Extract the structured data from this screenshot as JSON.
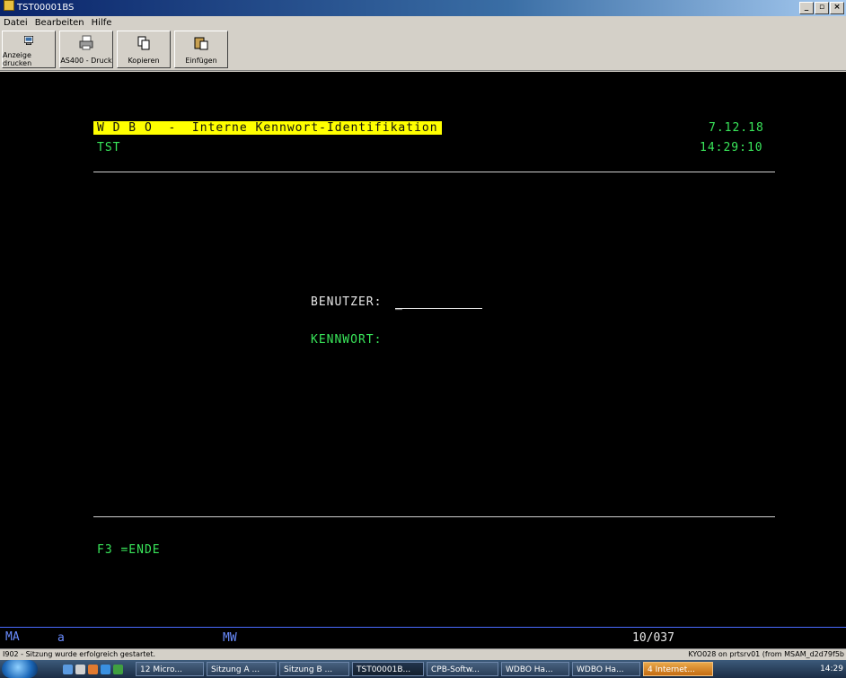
{
  "window": {
    "title": "TST00001BS"
  },
  "menu": [
    "Datei",
    "Bearbeiten",
    "Hilfe"
  ],
  "toolbar": [
    {
      "label": "Anzeige drucken",
      "icon": "print-screen-icon"
    },
    {
      "label": "AS400 - Druck",
      "icon": "printer-icon"
    },
    {
      "label": "Kopieren",
      "icon": "copy-icon"
    },
    {
      "label": "Einfügen",
      "icon": "paste-icon"
    }
  ],
  "screen": {
    "title": "W D B O  -  Interne Kennwort-Identifikation",
    "system": "TST",
    "date": "7.12.18",
    "time": "14:29:10",
    "user_label": "BENUTZER:",
    "user_value": "_",
    "password_label": "KENNWORT:",
    "fkey": "F3 =ENDE"
  },
  "status_row": {
    "ma": "MA",
    "a": "a",
    "mw": "MW",
    "pos": "10/037"
  },
  "message_bar": {
    "left": "I902 - Sitzung wurde erfolgreich gestartet.",
    "right": "KYO028 on prtsrv01 (from MSAM_d2d79f5b"
  },
  "taskbar": {
    "tasks": [
      "12 Micro...",
      "Sitzung A ...",
      "Sitzung B ...",
      "TST00001B...",
      "CPB-Softw...",
      "WDBO Ha...",
      "WDBO Ha...",
      "4 Internet..."
    ],
    "clock": "14:29"
  },
  "colors": {
    "terminal_green": "#39e65a",
    "highlight_yellow": "#ffff00",
    "status_blue": "#6a8cff"
  }
}
